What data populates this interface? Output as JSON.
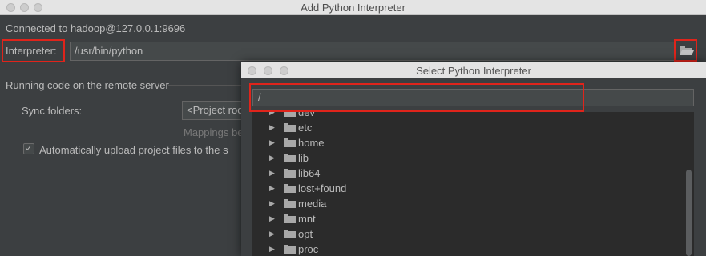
{
  "main_window": {
    "title": "Add Python Interpreter",
    "connected_text": "Connected to hadoop@127.0.0.1:9696",
    "interpreter_label": "Interpreter:",
    "interpreter_value": "/usr/bin/python",
    "section_title": "Running code on the remote server",
    "sync_label": "Sync folders:",
    "sync_value": "<Project roo",
    "mappings_hint": "Mappings be",
    "auto_upload_label": "Automatically upload project files to the s",
    "auto_upload_checked": true
  },
  "popup": {
    "title": "Select Python Interpreter",
    "path_value": "/",
    "tree_items": [
      "dev",
      "etc",
      "home",
      "lib",
      "lib64",
      "lost+found",
      "media",
      "mnt",
      "opt",
      "proc"
    ]
  },
  "colors": {
    "highlight": "#e0241b",
    "background": "#3c3f41",
    "tree_background": "#2b2b2b"
  }
}
